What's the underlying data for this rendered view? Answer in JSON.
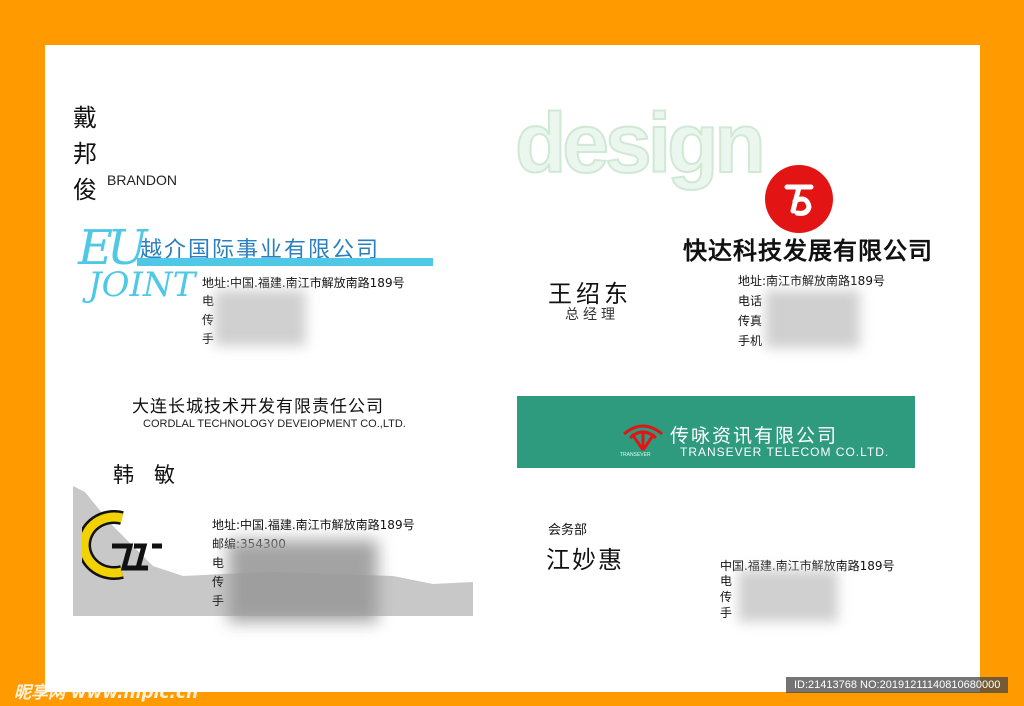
{
  "card1": {
    "name_chars": [
      "戴",
      "邦",
      "俊"
    ],
    "name_en": "BRANDON",
    "company": "越介国际事业有限公司",
    "logo_text_1": "EU",
    "logo_text_2": "JOINT",
    "addr": "地址:中国.福建.南江市解放南路189号",
    "lines": [
      "电",
      "传",
      "手"
    ]
  },
  "card2": {
    "watermark": "design",
    "company": "快达科技发展有限公司",
    "name": "王绍东",
    "title": "总经理",
    "addr": "地址:南江市解放南路189号",
    "lines": [
      "电话",
      "传真",
      "手机"
    ]
  },
  "card3": {
    "company": "大连长城技术开发有限责任公司",
    "company_en": "CORDLAL TECHNOLOGY DEVEIOPMENT CO.,LTD.",
    "name": "韩   敏",
    "addr": "地址:中国.福建.南江市解放南路189号",
    "lines": [
      "邮编:354300",
      "电",
      "传",
      "手"
    ]
  },
  "card4": {
    "company": "传咏资讯有限公司",
    "company_en": "TRANSEVER TELECOM CO.LTD.",
    "logo_small": "TRANSEVER",
    "dept": "会务部",
    "name": "江妙惠",
    "addr": "中国.福建.南江市解放南路189号",
    "lines": [
      "电",
      "传",
      "手"
    ]
  },
  "footer": {
    "site": "昵享网 www.nipic.cn",
    "id_text": "ID:21413768 NO:20191211140810680000"
  },
  "colors": {
    "frame": "#ff9a00",
    "teal": "#2e9a7e",
    "cyan": "#4fc8e6",
    "red": "#e31414",
    "gray": "#c8c8c8"
  }
}
